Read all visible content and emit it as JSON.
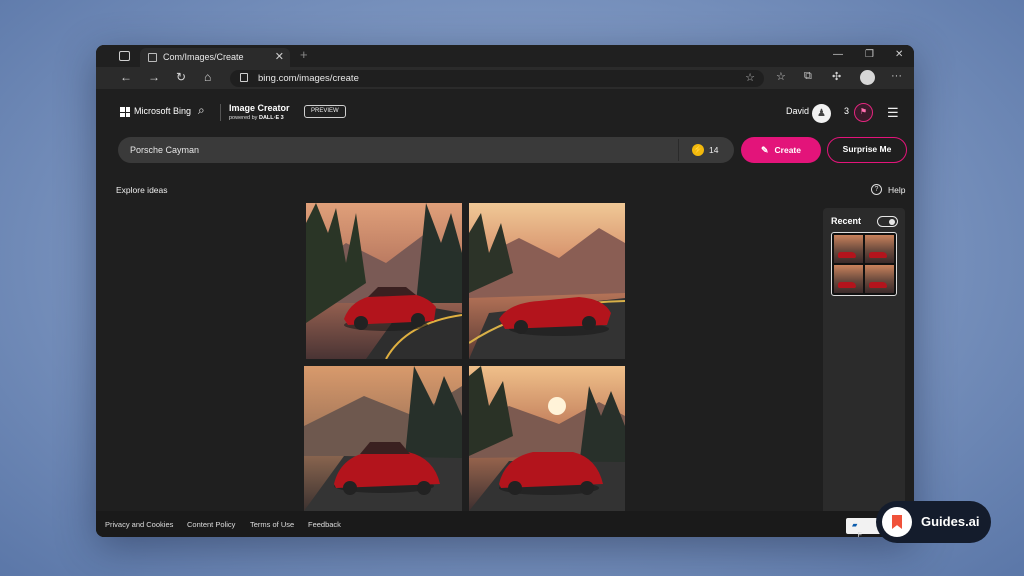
{
  "browser": {
    "tab_title": "Com/Images/Create",
    "new_tab": "+",
    "url": "bing.com/images/create",
    "win_min": "—",
    "win_max": "❐",
    "win_close": "✕",
    "tab_close": "✕",
    "nav_back": "←",
    "nav_forward": "→",
    "nav_refresh": "↻",
    "nav_home": "⌂",
    "more": "···"
  },
  "header": {
    "brand": "Microsoft Bing",
    "app_title": "Image Creator",
    "powered_prefix": "powered by ",
    "powered_model": "DALL·E 3",
    "preview_badge": "PREVIEW",
    "user_name": "David",
    "reward_count": "3"
  },
  "prompt": {
    "text": "Porsche Cayman",
    "boosts": "14",
    "create_label": "Create",
    "surprise_label": "Surprise Me"
  },
  "explore_label": "Explore ideas",
  "help_label": "Help",
  "recent": {
    "title": "Recent",
    "toggle_on": true
  },
  "images": [
    {
      "alt": "red Porsche Cayman on mountain road, pine forest",
      "caption_icon": "image-1"
    },
    {
      "alt": "red Porsche convertible on curvy road at sunset",
      "caption_icon": "image-2"
    },
    {
      "alt": "red Porsche Cayman front view on highway at dusk",
      "caption_icon": "image-3"
    },
    {
      "alt": "red Porsche Cayman on forest road with sunset",
      "caption_icon": "image-4"
    }
  ],
  "footer": {
    "privacy": "Privacy and Cookies",
    "content_policy": "Content Policy",
    "terms": "Terms of Use",
    "feedback": "Feedback",
    "feedback_button": "F"
  },
  "badge": {
    "label": "Guides.ai"
  },
  "colors": {
    "accent": "#e3147a",
    "page_bg": "#1f1f1f",
    "boost": "#f2b90c"
  }
}
